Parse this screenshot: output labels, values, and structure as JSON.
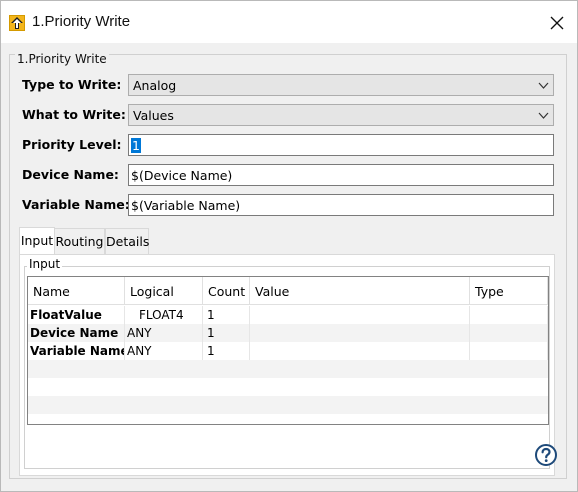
{
  "window": {
    "title": "1.Priority Write"
  },
  "group": {
    "legend": "1.Priority Write"
  },
  "form": {
    "type_to_write_label": "Type to Write:",
    "type_to_write_value": "Analog",
    "what_to_write_label": "What to Write:",
    "what_to_write_value": "Values",
    "priority_level_label": "Priority Level:",
    "priority_level_value": "1",
    "device_name_label": "Device Name:",
    "device_name_value": "$(Device Name)",
    "variable_name_label": "Variable Name:",
    "variable_name_value": "$(Variable Name)"
  },
  "tabs": [
    "Input",
    "Routing",
    "Details"
  ],
  "input_group": {
    "legend": "Input"
  },
  "grid": {
    "columns": [
      "Name",
      "Logical",
      "Count",
      "Value",
      "Type"
    ],
    "rows": [
      {
        "name": "FloatValue",
        "logical": "FLOAT4",
        "count": "1",
        "value": "",
        "type": ""
      },
      {
        "name": "Device Name",
        "logical": "ANY",
        "count": "1",
        "value": "",
        "type": ""
      },
      {
        "name": "Variable Name",
        "logical": "ANY",
        "count": "1",
        "value": "",
        "type": ""
      }
    ]
  },
  "icons": {
    "app": "priority-write-icon",
    "close": "close-icon",
    "combo_arrow": "chevron-down-icon",
    "help": "help-icon"
  },
  "colors": {
    "selection": "#0078d7",
    "help_icon": "#1e4a7a",
    "app_icon": "#f3b51b"
  }
}
